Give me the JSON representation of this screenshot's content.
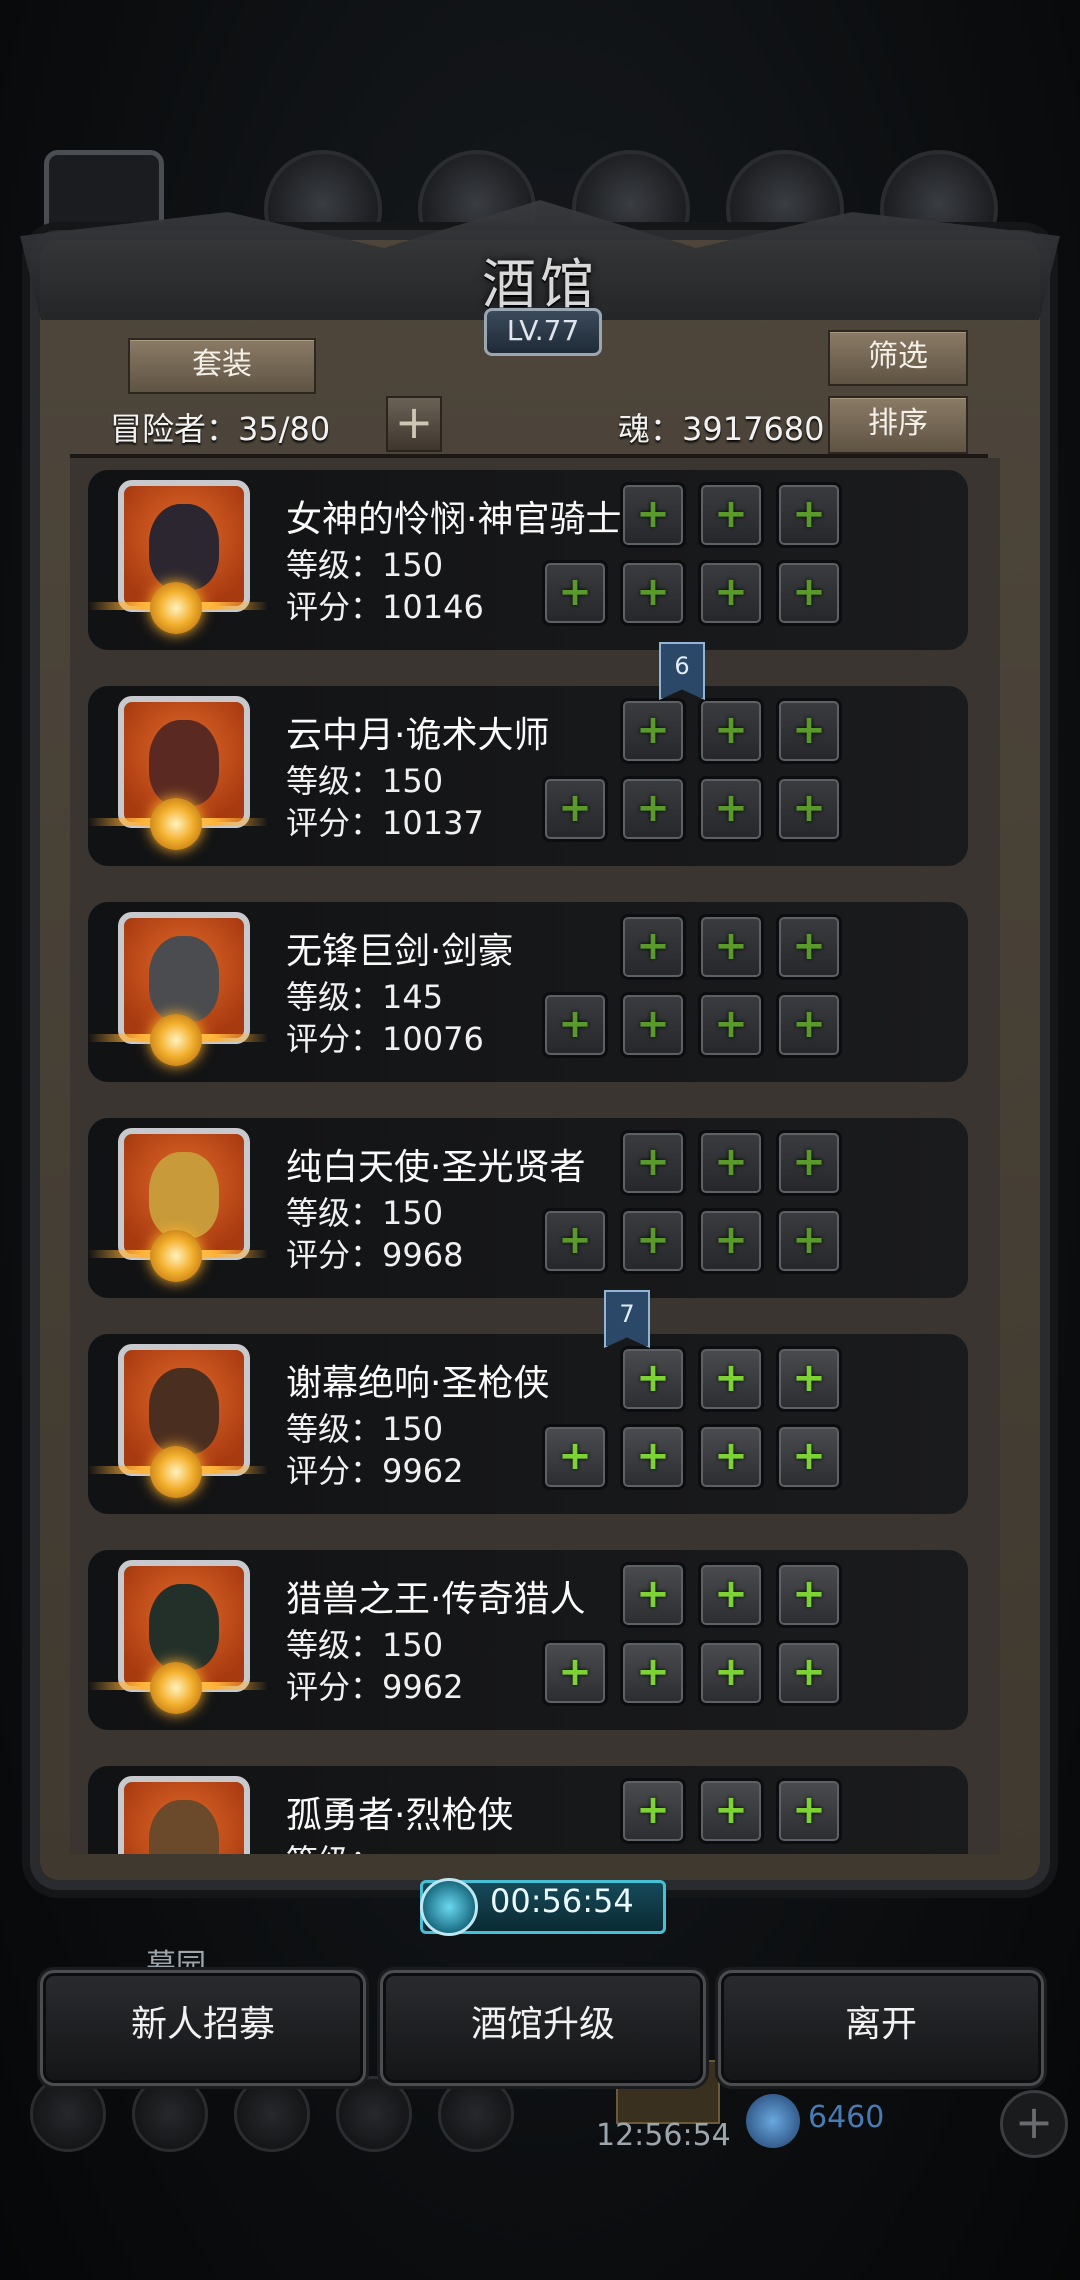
{
  "header": {
    "title": "酒馆",
    "level": "LV.77"
  },
  "toolbar": {
    "set_label": "套装",
    "filter_label": "筛选",
    "sort_label": "排序",
    "adventurers_label": "冒险者：35/80",
    "soul_label": "魂：3917680"
  },
  "heroes": [
    {
      "name": "女神的怜悯·神官骑士",
      "level": "等级：150",
      "score": "评分：10146",
      "portrait_color": "#2b2630"
    },
    {
      "name": "云中月·诡术大师",
      "level": "等级：150",
      "score": "评分：10137",
      "portrait_color": "#5a2a22"
    },
    {
      "name": "无锋巨剑·剑豪",
      "level": "等级：145",
      "score": "评分：10076",
      "portrait_color": "#4a4c50"
    },
    {
      "name": "纯白天使·圣光贤者",
      "level": "等级：150",
      "score": "评分：9968",
      "portrait_color": "#c89a3a"
    },
    {
      "name": "谢幕绝响·圣枪侠",
      "level": "等级：150",
      "score": "评分：9962",
      "portrait_color": "#4a2e20"
    },
    {
      "name": "猎兽之王·传奇猎人",
      "level": "等级：150",
      "score": "评分：9962",
      "portrait_color": "#23302a"
    },
    {
      "name": "孤勇者·烈枪侠",
      "level": "等级：",
      "score": "",
      "portrait_color": "#6a4a2a"
    }
  ],
  "ribbons": [
    "6",
    "7"
  ],
  "timer": "00:56:54",
  "bottom_buttons": {
    "recruit": "新人招募",
    "upgrade": "酒馆升级",
    "leave": "离开"
  },
  "background_hud": {
    "area_label": "墓园",
    "clock": "12:56:54",
    "gems": "6460"
  },
  "icons": [
    "slot-plus-icon",
    "timer-clock-icon",
    "add-icon"
  ],
  "colors": {
    "accent_green": "#7ed334",
    "timer_cyan": "#48c0d8",
    "emblem_gold": "#f3b02e"
  }
}
